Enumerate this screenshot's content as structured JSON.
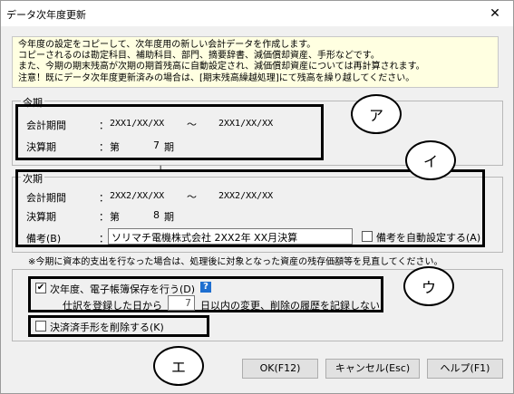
{
  "window": {
    "title": "データ次年度更新",
    "close_glyph": "✕"
  },
  "notice": {
    "line1": "今年度の設定をコピーして、次年度用の新しい会計データを作成します。",
    "line2": "コピーされるのは勘定科目、補助科目、部門、摘要辞書、減価償却資産、手形などです。",
    "line3": "また、今期の期末残高が次期の期首残高に自動設定され、減価償却資産については再計算されます。",
    "line4": "注意！既にデータ次年度更新済みの場合は、[期末残高繰越処理]にて残高を繰り越してください。"
  },
  "current_period": {
    "group_label": "今期",
    "period_label": "会計期間",
    "period_sep": "：",
    "period_from": "2XX1/XX/XX",
    "period_tilde": "～",
    "period_to": "2XX1/XX/XX",
    "term_label": "決算期",
    "term_sep": "：",
    "term_prefix": "第",
    "term_number": "7",
    "term_suffix": "期"
  },
  "arrow": "↓",
  "next_period": {
    "group_label": "次期",
    "period_label": "会計期間",
    "period_sep": "：",
    "period_from": "2XX2/XX/XX",
    "period_tilde": "～",
    "period_to": "2XX2/XX/XX",
    "term_label": "決算期",
    "term_sep": "：",
    "term_prefix": "第",
    "term_number": "8",
    "term_suffix": "期",
    "memo_label": "備考(B)",
    "memo_sep": "：",
    "memo_value": "ソリマチ電機株式会社 2XX2年 XX月決算",
    "auto_memo_label": "備考を自動設定する(A)"
  },
  "capex_note": "※今期に資本的支出を行なった場合は、処理後に対象となった資産の残存価額等を見直してください。",
  "ebook": {
    "checkbox_label": "次年度、電子帳簿保存を行う(D)",
    "checked_glyph": "✔",
    "help_glyph": "?",
    "days_prefix": "仕訳を登録した日から",
    "days_value": "7",
    "days_suffix": "日以内の変更、削除の履歴を記録しない"
  },
  "delete_bills": {
    "checkbox_label": "決済済手形を削除する(K)"
  },
  "callouts": {
    "a": "ア",
    "i": "イ",
    "u": "ウ",
    "e": "エ"
  },
  "buttons": {
    "ok": "OK(F12)",
    "cancel": "キャンセル(Esc)",
    "help": "ヘルプ(F1)"
  }
}
